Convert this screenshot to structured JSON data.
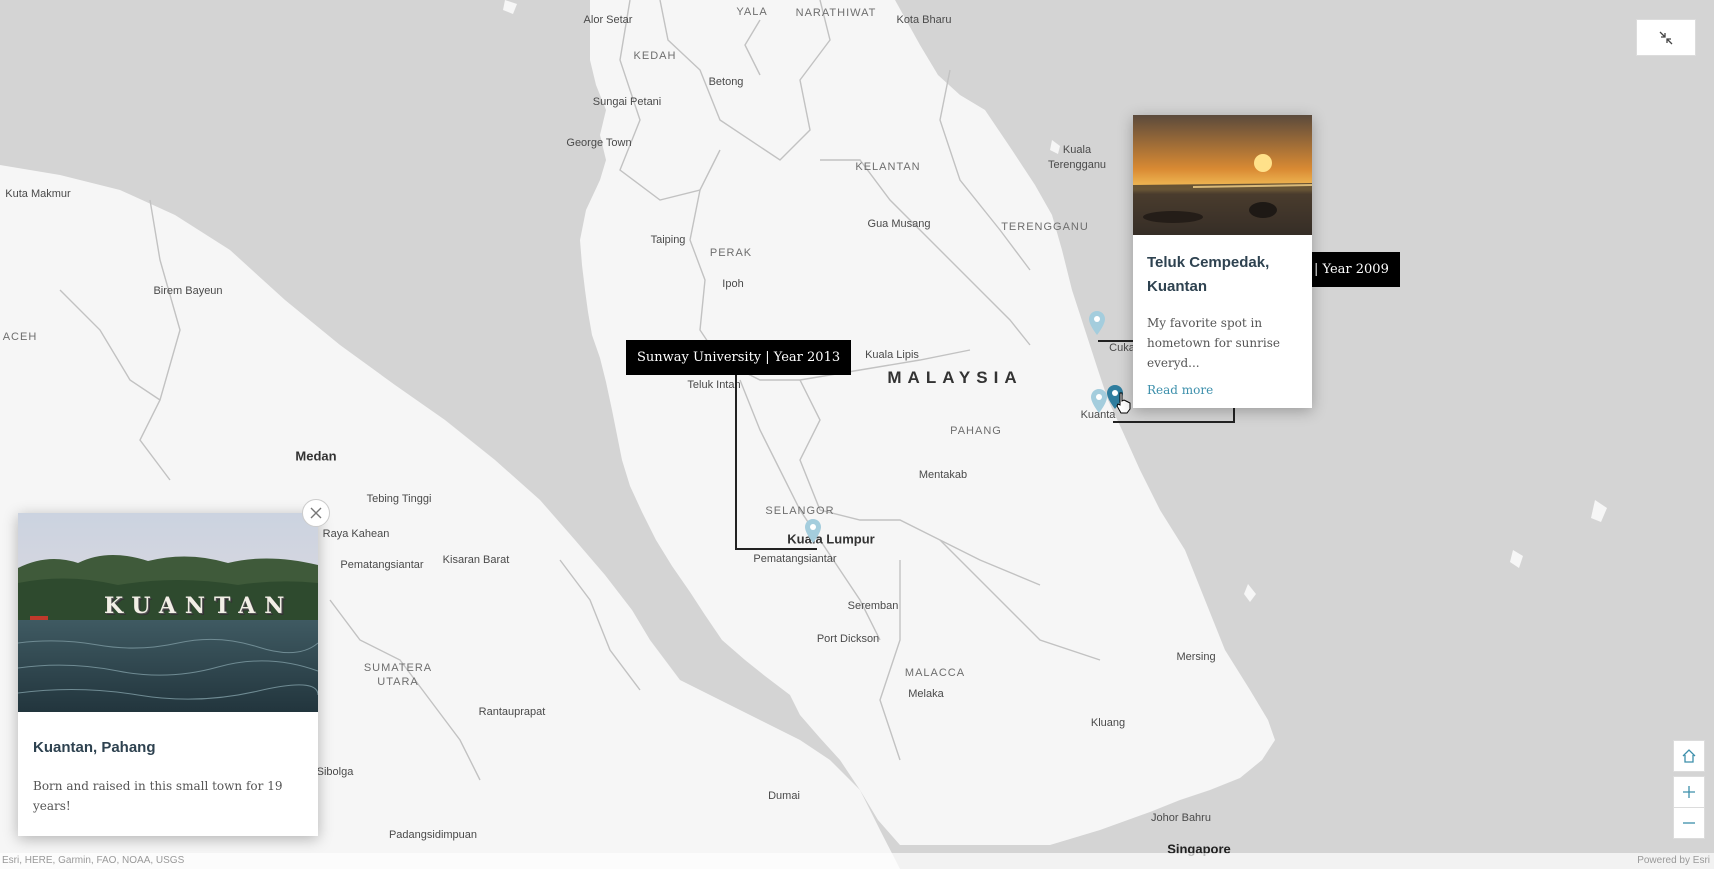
{
  "map": {
    "labels": {
      "alor_setar": "Alor Setar",
      "yala": "YALA",
      "narathiwat": "NARATHIWAT",
      "kota_bharu": "Kota Bharu",
      "kedah": "KEDAH",
      "betong": "Betong",
      "sungai_petani": "Sungai Petani",
      "george_town": "George Town",
      "kuta_makmur": "Kuta Makmur",
      "kelantan": "KELANTAN",
      "kuala_terengganu": "Kuala\nTerengganu",
      "terengganu": "TERENGGANU",
      "gua_musang": "Gua Musang",
      "taiping": "Taiping",
      "perak": "PERAK",
      "ipoh": "Ipoh",
      "birem_bayeun": "Birem Bayeun",
      "aceh": "ACEH",
      "kuala_lipis": "Kuala Lipis",
      "malaysia": "MALAYSIA",
      "teluk_intan": "Teluk Intan",
      "pahang": "PAHANG",
      "cukai": "Cuka",
      "kuantan": "Kuanta",
      "mentakab": "Mentakab",
      "medan": "Medan",
      "tebing_tinggi": "Tebing Tinggi",
      "selangor": "SELANGOR",
      "kuala_lumpur": "Kuala Lumpur",
      "raya_kahean": "Raya Kahean",
      "pematangsiantar_1": "Pematangsiantar",
      "pematangsiantar_2": "Pematangsiantar",
      "kisaran_barat": "Kisaran Barat",
      "seremban": "Seremban",
      "port_dickson": "Port Dickson",
      "sumatera_utara": "SUMATERA\nUTARA",
      "malacca": "MALACCA",
      "melaka": "Melaka",
      "mersing": "Mersing",
      "rantauprapat": "Rantauprapat",
      "kluang": "Kluang",
      "sibolga": "Sibolga",
      "dumai": "Dumai",
      "johor_bahru": "Johor Bahru",
      "padangsidimpuan": "Padangsidimpuan",
      "singapore": "Singapore"
    },
    "timeline_tags": {
      "sunway": "Sunway University | Year 2013",
      "year_2009": "| Year 2009"
    },
    "attribution": "Esri, HERE, Garmin, FAO, NOAA, USGS",
    "powered_by": "Powered by Esri"
  },
  "popup_teluk": {
    "title": "Teluk Cempedak, Kuantan",
    "description": "My favorite spot in hometown for sunrise everyd...",
    "read_more": "Read more"
  },
  "popup_kuantan": {
    "image_text": "KUANTAN",
    "title": "Kuantan, Pahang",
    "description": "Born and raised in this small town for 19 years!"
  },
  "controls": {
    "collapse_icon": "collapse-icon",
    "home_icon": "home-icon",
    "zoom_in_icon": "plus-icon",
    "zoom_out_icon": "minus-icon"
  },
  "colors": {
    "land": "#f6f6f6",
    "water": "#d4d4d4",
    "pin_active": "#2f7d9e",
    "pin_inactive": "#a4cddd"
  }
}
